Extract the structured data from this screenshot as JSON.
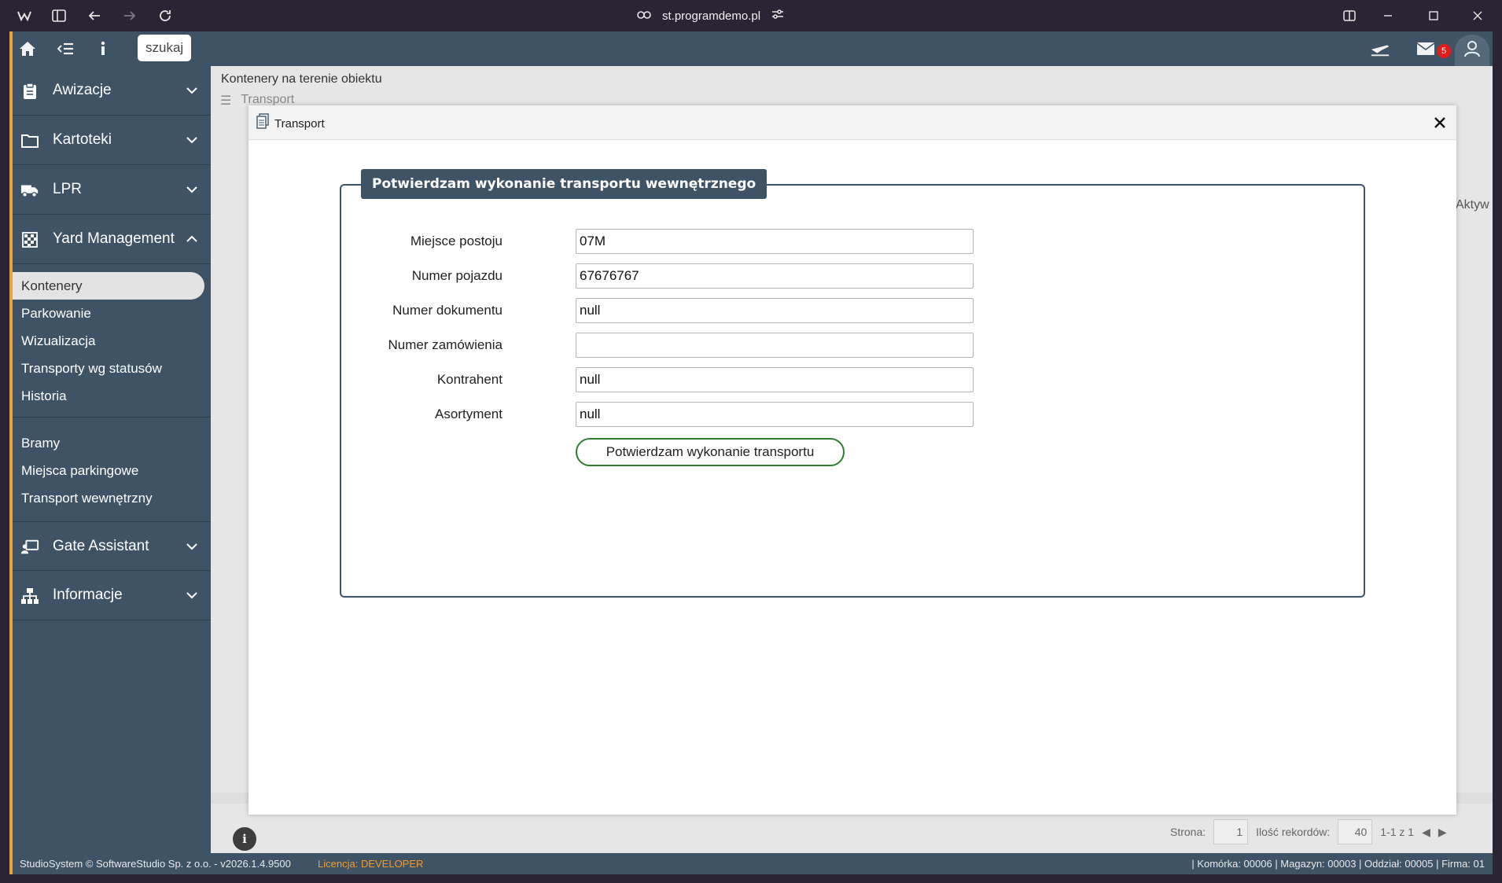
{
  "browser": {
    "url": "st.programdemo.pl"
  },
  "header": {
    "search_label": "szukaj",
    "mail_count": "5"
  },
  "sidebar": {
    "groups": [
      {
        "label": "Awizacje",
        "icon": "clipboard-icon"
      },
      {
        "label": "Kartoteki",
        "icon": "folder-icon"
      },
      {
        "label": "LPR",
        "icon": "truck-icon"
      },
      {
        "label": "Yard Management",
        "icon": "grid-icon"
      },
      {
        "label": "Gate Assistant",
        "icon": "gate-assistant-icon"
      },
      {
        "label": "Informacje",
        "icon": "sitemap-icon"
      }
    ],
    "yard_items": [
      "Kontenery",
      "Parkowanie",
      "Wizualizacja",
      "Transporty wg statusów",
      "Historia"
    ],
    "yard_items2": [
      "Bramy",
      "Miejsca parkingowe",
      "Transport wewnętrzny"
    ]
  },
  "content": {
    "breadcrumb": "Kontenery na terenie obiektu",
    "ghost_tab": "Transport",
    "ghost_column": "Aktyw",
    "pager": {
      "page_label": "Strona:",
      "page_value": "1",
      "records_label": "Ilość rekordów:",
      "records_value": "40",
      "range": "1-1 z 1"
    }
  },
  "modal": {
    "title": "Transport",
    "legend": "Potwierdzam wykonanie transportu wewnętrznego",
    "fields": [
      {
        "label": "Miejsce postoju",
        "value": "07M"
      },
      {
        "label": "Numer pojazdu",
        "value": "67676767"
      },
      {
        "label": "Numer dokumentu",
        "value": "null"
      },
      {
        "label": "Numer zamówienia",
        "value": ""
      },
      {
        "label": "Kontrahent",
        "value": "null"
      },
      {
        "label": "Asortyment",
        "value": "null"
      }
    ],
    "confirm_button": "Potwierdzam wykonanie transportu"
  },
  "status": {
    "left": "StudioSystem © SoftwareStudio Sp. z o.o. - v2026.1.4.9500",
    "license_label": "Licencja:",
    "license_value": "DEVELOPER",
    "right": "| Komórka: 00006 | Magazyn: 00003 | Oddział: 00005 | Firma: 01"
  },
  "colors": {
    "sidebar": "#3e5466",
    "accent": "#e8a33a",
    "confirm_border": "#2f7d2f",
    "badge": "#e21b1b"
  }
}
